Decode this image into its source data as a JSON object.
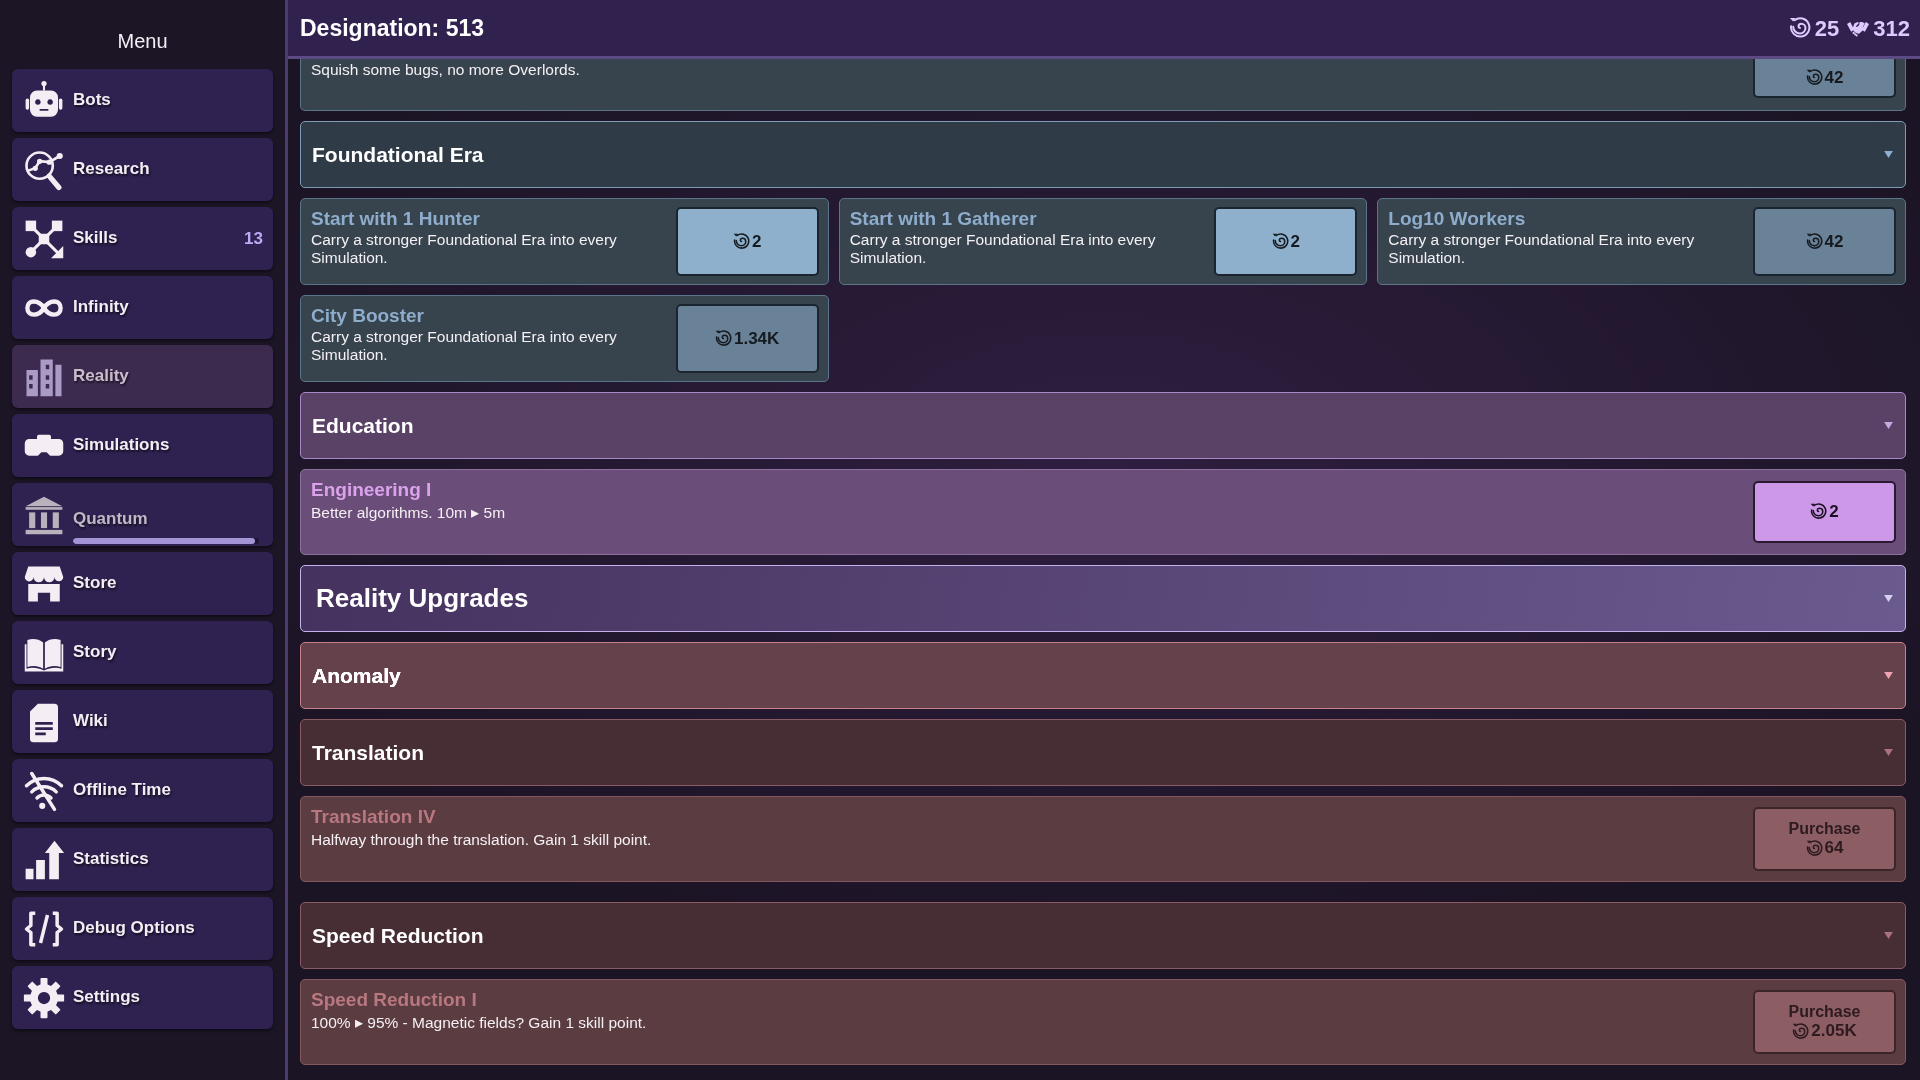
{
  "sidebar": {
    "title": "Menu",
    "items": [
      {
        "label": "Bots",
        "selected": false,
        "disabled": false
      },
      {
        "label": "Research",
        "selected": false,
        "disabled": false
      },
      {
        "label": "Skills",
        "selected": false,
        "disabled": false,
        "badge": "13"
      },
      {
        "label": "Infinity",
        "selected": false,
        "disabled": false
      },
      {
        "label": "Reality",
        "selected": true,
        "disabled": false
      },
      {
        "label": "Simulations",
        "selected": false,
        "disabled": false
      },
      {
        "label": "Quantum",
        "selected": false,
        "disabled": true,
        "level": 0.98
      },
      {
        "label": "Store",
        "selected": false,
        "disabled": false
      },
      {
        "label": "Story",
        "selected": false,
        "disabled": false
      },
      {
        "label": "Wiki",
        "selected": false,
        "disabled": false
      },
      {
        "label": "Offline Time",
        "selected": false,
        "disabled": false
      },
      {
        "label": "Statistics",
        "selected": false,
        "disabled": false
      },
      {
        "label": "Debug Options",
        "selected": false,
        "disabled": false
      },
      {
        "label": "Settings",
        "selected": false,
        "disabled": false
      }
    ]
  },
  "header": {
    "title": "Designation: 513",
    "resources": [
      {
        "amount": "25"
      },
      {
        "amount": "312"
      }
    ]
  },
  "sections": [
    {
      "kind": "era",
      "upgrades": [
        {
          "kind": "row",
          "description": "Squish some bugs, no more Overlords.",
          "cost": "42",
          "affordable": false
        }
      ]
    },
    {
      "kind": "era",
      "title": "Foundational Era",
      "expanded": true,
      "upgrades": [
        {
          "kind": "tile",
          "title": "Start with 1 Hunter",
          "description": "Carry a stronger Foundational Era into every Simulation.",
          "cost": "2",
          "affordable": true
        },
        {
          "kind": "tile",
          "title": "Start with 1 Gatherer",
          "description": "Carry a stronger Foundational Era into every Simulation.",
          "cost": "2",
          "affordable": true
        },
        {
          "kind": "tile",
          "title": "Log10 Workers",
          "description": "Carry a stronger Foundational Era into every Simulation.",
          "cost": "42",
          "affordable": false
        },
        {
          "kind": "tile",
          "title": "City Booster",
          "description": "Carry a stronger Foundational Era into every Simulation.",
          "cost": "1.34K",
          "affordable": false
        }
      ]
    },
    {
      "kind": "education",
      "title": "Education",
      "expanded": true,
      "upgrades": [
        {
          "kind": "row",
          "title": "Engineering I",
          "description": "Better algorithms. 10m ▸ 5m",
          "cost": "2",
          "affordable": true
        }
      ]
    },
    {
      "kind": "category",
      "title": "Reality Upgrades",
      "expanded": true
    },
    {
      "kind": "anomaly",
      "title": "Anomaly",
      "expanded": false
    },
    {
      "kind": "anomaly",
      "title": "Translation",
      "expanded": true,
      "upgrades": [
        {
          "kind": "row",
          "title": "Translation IV",
          "description": "Halfway through the translation. Gain 1 skill point.",
          "button_label": "Purchase",
          "cost": "64",
          "affordable": false
        }
      ]
    },
    {
      "kind": "anomaly",
      "title": "Speed Reduction",
      "expanded": true,
      "upgrades": [
        {
          "kind": "row",
          "title": "Speed Reduction I",
          "description": "100% ▸ 95% - Magnetic fields? Gain 1 skill point.",
          "button_label": "Purchase",
          "cost": "2.05K",
          "affordable": false
        }
      ]
    }
  ]
}
